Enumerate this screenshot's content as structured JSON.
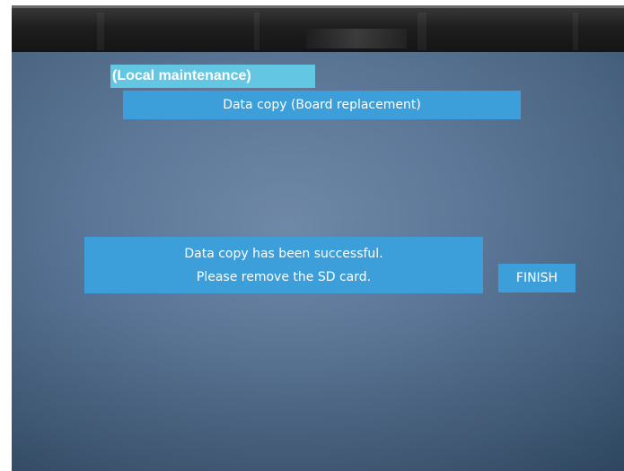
{
  "screen": {
    "section_label": "(Local maintenance)",
    "title": "Data copy (Board replacement)",
    "message": {
      "line1": "Data copy has been successful.",
      "line2": "Please remove the SD card."
    },
    "finish_button": "FINISH"
  },
  "colors": {
    "screen_background": "#5a7596",
    "panel_blue": "#3d9fda",
    "label_cyan": "#63c6e3",
    "text": "#ffffff",
    "bezel": "#1e1e1e"
  }
}
